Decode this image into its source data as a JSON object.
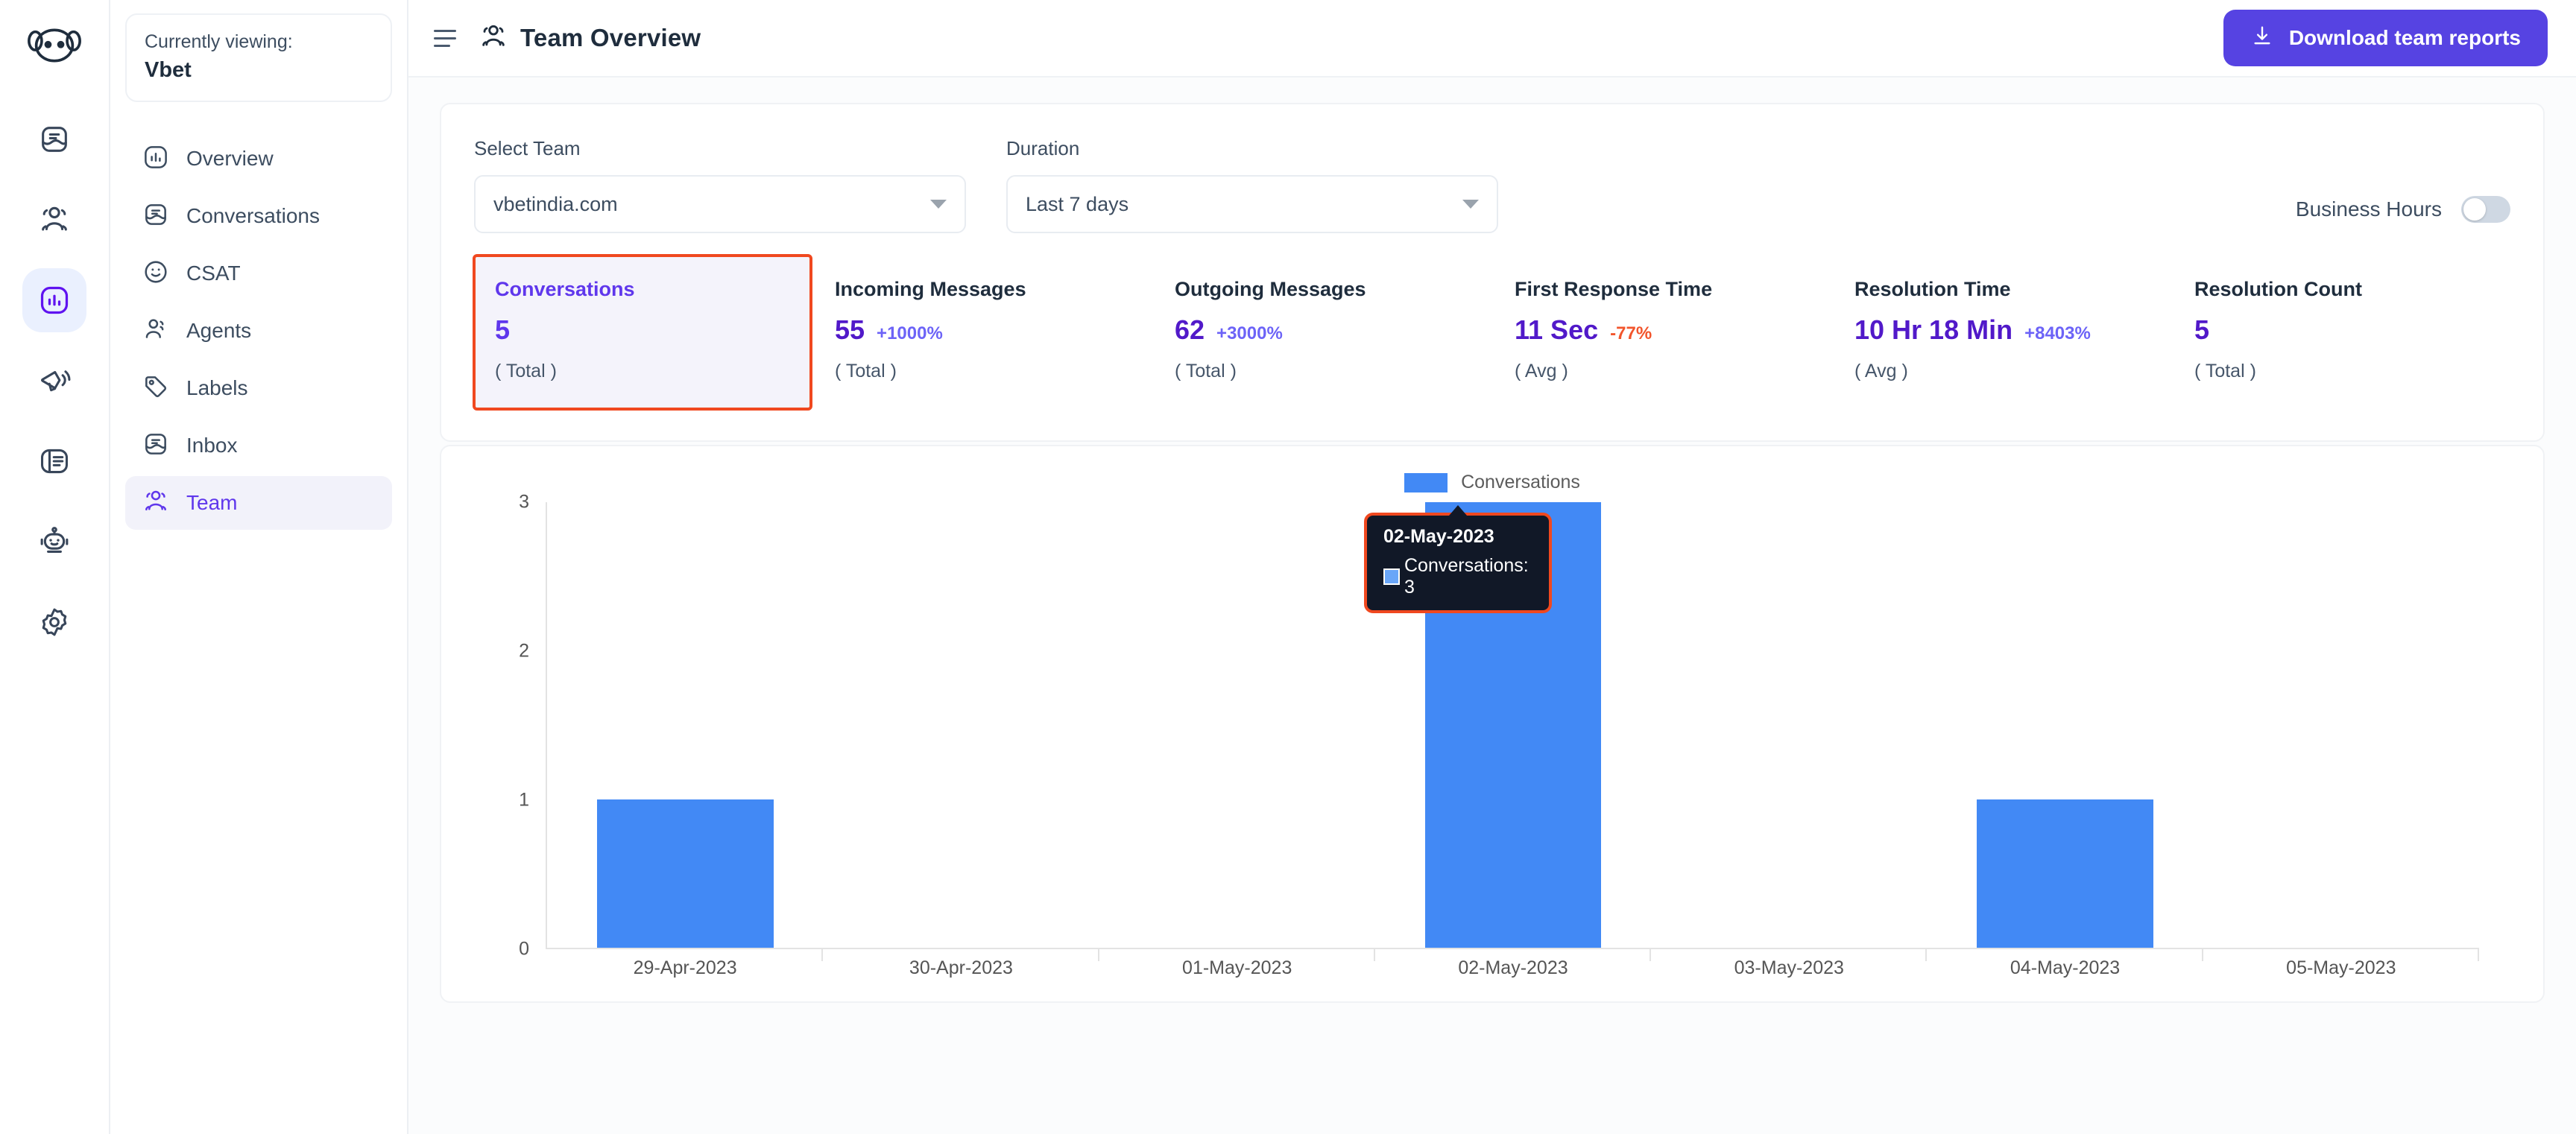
{
  "rail": {
    "logo_icon": "chatwoot-logo-icon",
    "items": [
      {
        "icon": "conversations-icon",
        "name": "conversations",
        "active": false
      },
      {
        "icon": "contacts-icon",
        "name": "contacts",
        "active": false
      },
      {
        "icon": "reports-bar-chart-icon",
        "name": "reports",
        "active": true
      },
      {
        "icon": "campaigns-megaphone-icon",
        "name": "campaigns",
        "active": false
      },
      {
        "icon": "help-center-book-icon",
        "name": "help-center",
        "active": false
      },
      {
        "icon": "bots-robot-icon",
        "name": "bots",
        "active": false
      },
      {
        "icon": "settings-gear-icon",
        "name": "settings",
        "active": false
      }
    ]
  },
  "sidebar": {
    "viewing_label": "Currently viewing:",
    "account_name": "Vbet",
    "items": [
      {
        "label": "Overview",
        "icon": "overview-bar-chart-icon",
        "active": false
      },
      {
        "label": "Conversations",
        "icon": "conversations-icon",
        "active": false
      },
      {
        "label": "CSAT",
        "icon": "csat-smiley-icon",
        "active": false
      },
      {
        "label": "Agents",
        "icon": "agents-people-icon",
        "active": false
      },
      {
        "label": "Labels",
        "icon": "labels-tag-icon",
        "active": false
      },
      {
        "label": "Inbox",
        "icon": "inbox-icon",
        "active": false
      },
      {
        "label": "Team",
        "icon": "team-people-icon",
        "active": true
      }
    ]
  },
  "topbar": {
    "menu_icon": "hamburger-menu-icon",
    "title_icon": "team-people-icon",
    "title": "Team Overview",
    "download_icon": "download-arrow-icon",
    "download_label": "Download team reports"
  },
  "filters": {
    "team": {
      "label": "Select Team",
      "value": "vbetindia.com"
    },
    "duration": {
      "label": "Duration",
      "value": "Last 7 days"
    },
    "business_hours": {
      "label": "Business Hours",
      "enabled": false
    }
  },
  "metrics": [
    {
      "name": "Conversations",
      "value": "5",
      "delta": "",
      "delta_negative": false,
      "sub": "( Total )",
      "selected": true
    },
    {
      "name": "Incoming Messages",
      "value": "55",
      "delta": "+1000%",
      "delta_negative": false,
      "sub": "( Total )",
      "selected": false
    },
    {
      "name": "Outgoing Messages",
      "value": "62",
      "delta": "+3000%",
      "delta_negative": false,
      "sub": "( Total )",
      "selected": false
    },
    {
      "name": "First Response Time",
      "value": "11 Sec",
      "delta": "-77%",
      "delta_negative": true,
      "sub": "( Avg )",
      "selected": false
    },
    {
      "name": "Resolution Time",
      "value": "10 Hr 18 Min",
      "delta": "+8403%",
      "delta_negative": false,
      "sub": "( Avg )",
      "selected": false
    },
    {
      "name": "Resolution Count",
      "value": "5",
      "delta": "",
      "delta_negative": false,
      "sub": "( Total )",
      "selected": false
    }
  ],
  "chart_data": {
    "type": "bar",
    "title": "",
    "xlabel": "",
    "ylabel": "",
    "categories": [
      "29-Apr-2023",
      "30-Apr-2023",
      "01-May-2023",
      "02-May-2023",
      "03-May-2023",
      "04-May-2023",
      "05-May-2023"
    ],
    "series": [
      {
        "name": "Conversations",
        "color": "#4289f5",
        "values": [
          1,
          0,
          0,
          3,
          0,
          1,
          0
        ]
      }
    ],
    "yticks": [
      "0",
      "1",
      "2",
      "3"
    ],
    "ylim": [
      0,
      3
    ],
    "grid": false,
    "legend": {
      "position": "top-center",
      "entries": [
        "Conversations"
      ]
    },
    "tooltip": {
      "visible": true,
      "category": "02-May-2023",
      "series_name": "Conversations",
      "value": "3",
      "text": "Conversations: 3"
    }
  },
  "colors": {
    "brand_purple": "#5643e2",
    "accent_violet": "#5f37ec",
    "bar_blue": "#4289f5",
    "highlight_red": "#f0481f",
    "negative_red": "#f2552c"
  }
}
